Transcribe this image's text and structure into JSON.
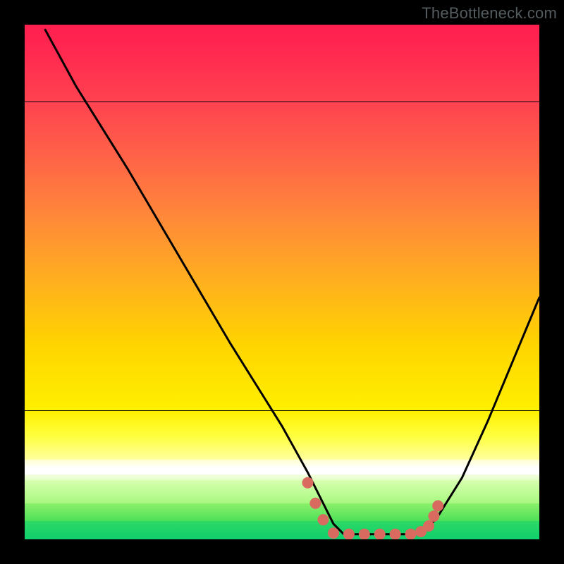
{
  "watermark": {
    "text": "TheBottleneck.com"
  },
  "chart_data": {
    "type": "line",
    "title": "",
    "xlabel": "",
    "ylabel": "",
    "xlim": [
      0,
      100
    ],
    "ylim": [
      0,
      100
    ],
    "series": [
      {
        "name": "bottleneck-curve",
        "x": [
          4,
          10,
          20,
          30,
          40,
          50,
          55,
          58,
          60,
          62,
          70,
          75,
          78,
          80,
          85,
          90,
          95,
          100
        ],
        "y": [
          99,
          88,
          72,
          55,
          38,
          22,
          13,
          7,
          3,
          1,
          1,
          1,
          2,
          4,
          12,
          23,
          35,
          47
        ]
      }
    ],
    "highlight_points": {
      "name": "flat-zone-dots",
      "color": "#d86a60",
      "points": [
        {
          "x": 55,
          "y": 11
        },
        {
          "x": 56.5,
          "y": 7
        },
        {
          "x": 58,
          "y": 3.8
        },
        {
          "x": 60,
          "y": 1.2
        },
        {
          "x": 63,
          "y": 1.0
        },
        {
          "x": 66,
          "y": 1.0
        },
        {
          "x": 69,
          "y": 1.0
        },
        {
          "x": 72,
          "y": 1.0
        },
        {
          "x": 75,
          "y": 1.0
        },
        {
          "x": 77,
          "y": 1.5
        },
        {
          "x": 78.5,
          "y": 2.6
        },
        {
          "x": 79.5,
          "y": 4.5
        },
        {
          "x": 80.3,
          "y": 6.5
        }
      ]
    },
    "background_bands": [
      {
        "from": 0.0,
        "to": 0.06,
        "top": "#ff1f4f",
        "bottom": "#ff2a50"
      },
      {
        "from": 0.06,
        "to": 0.15,
        "top": "#ff2a50",
        "bottom": "#ff4250"
      },
      {
        "from": 0.15,
        "to": 0.26,
        "top": "#ff4250",
        "bottom": "#ff6447"
      },
      {
        "from": 0.26,
        "to": 0.38,
        "top": "#ff6447",
        "bottom": "#ff8a38"
      },
      {
        "from": 0.38,
        "to": 0.5,
        "top": "#ff8a38",
        "bottom": "#ffb01e"
      },
      {
        "from": 0.5,
        "to": 0.62,
        "top": "#ffb01e",
        "bottom": "#ffd400"
      },
      {
        "from": 0.62,
        "to": 0.75,
        "top": "#ffd400",
        "bottom": "#fff000"
      },
      {
        "from": 0.75,
        "to": 0.8,
        "top": "#fff000",
        "bottom": "#ffff40"
      },
      {
        "from": 0.8,
        "to": 0.845,
        "top": "#ffff40",
        "bottom": "#ffffa0"
      },
      {
        "from": 0.845,
        "to": 0.862,
        "top": "#ffffd0",
        "bottom": "#ffffff"
      },
      {
        "from": 0.862,
        "to": 0.874,
        "top": "#ffffff",
        "bottom": "#ffffff"
      },
      {
        "from": 0.874,
        "to": 0.885,
        "top": "#f2ffe0",
        "bottom": "#e6ffc8"
      },
      {
        "from": 0.885,
        "to": 0.93,
        "top": "#d8ffb0",
        "bottom": "#a8f880"
      },
      {
        "from": 0.93,
        "to": 0.965,
        "top": "#8cf06a",
        "bottom": "#4ee05a"
      },
      {
        "from": 0.965,
        "to": 1.0,
        "top": "#2dd964",
        "bottom": "#0fcf6e"
      }
    ],
    "curve_stroke": "#000000",
    "curve_width": 3
  }
}
